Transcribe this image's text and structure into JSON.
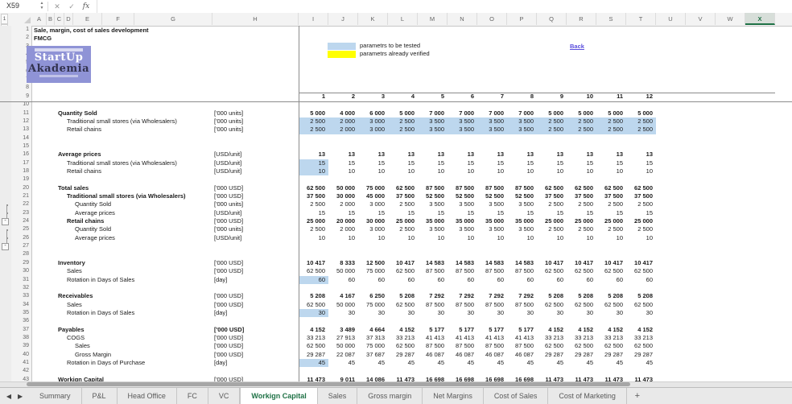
{
  "formula_bar": {
    "name_box": "X59",
    "cancel_label": "✕",
    "enter_label": "✓",
    "fx_label": "fx",
    "formula_value": ""
  },
  "colors": {
    "highlight_blue": "#BDD7EE",
    "verified_yellow": "#FFFF00",
    "active_tab_green": "#1E7145",
    "link_color": "#5B4FDD",
    "logo_purple": "#8F93D6"
  },
  "sheet": {
    "title": "Sale, margin, cost of sales development",
    "subtitle": "FMCG",
    "logo": {
      "line1": "StartUp",
      "line2": "Akademia"
    },
    "legend": [
      {
        "label": "parametrs to be tested",
        "color": "#BDD7EE"
      },
      {
        "label": "parametrs already verified",
        "color": "#FFFF00"
      }
    ],
    "back_link": "Back",
    "column_letters": [
      "A",
      "B",
      "C",
      "D",
      "E",
      "F",
      "G",
      "H",
      "I",
      "J",
      "K",
      "L",
      "M",
      "N",
      "O",
      "P",
      "Q",
      "R",
      "S",
      "T",
      "U",
      "V",
      "W",
      "X"
    ],
    "selected_column": "X",
    "outline_levels": [
      "1",
      "2"
    ],
    "outline": {
      "detail_rows": [
        22,
        23,
        25,
        26
      ],
      "collapse_rows": [
        24,
        27
      ],
      "collapse_symbol": "-"
    },
    "visible_row_count": 44,
    "period_headers": [
      "1",
      "2",
      "3",
      "4",
      "5",
      "6",
      "7",
      "8",
      "9",
      "10",
      "11",
      "12"
    ],
    "rows": [
      {
        "row": 11,
        "label": "Quantity Sold",
        "unit": "['000 units]",
        "bold": true,
        "indent": 1,
        "values": [
          "5 000",
          "4 000",
          "6 000",
          "5 000",
          "7 000",
          "7 000",
          "7 000",
          "7 000",
          "5 000",
          "5 000",
          "5 000",
          "5 000"
        ]
      },
      {
        "row": 12,
        "label": "Traditional small stores (via Wholesalers)",
        "unit": "['000 units]",
        "indent": 2,
        "highlight": "row",
        "values": [
          "2 500",
          "2 000",
          "3 000",
          "2 500",
          "3 500",
          "3 500",
          "3 500",
          "3 500",
          "2 500",
          "2 500",
          "2 500",
          "2 500"
        ]
      },
      {
        "row": 13,
        "label": "Retail chains",
        "unit": "['000 units]",
        "indent": 2,
        "highlight": "row",
        "values": [
          "2 500",
          "2 000",
          "3 000",
          "2 500",
          "3 500",
          "3 500",
          "3 500",
          "3 500",
          "2 500",
          "2 500",
          "2 500",
          "2 500"
        ]
      },
      {
        "row": 16,
        "label": "Average prices",
        "unit": "[USD/unit]",
        "bold": true,
        "indent": 1,
        "values": [
          "13",
          "13",
          "13",
          "13",
          "13",
          "13",
          "13",
          "13",
          "13",
          "13",
          "13",
          "13"
        ]
      },
      {
        "row": 17,
        "label": "Traditional small stores (via Wholesalers)",
        "unit": "[USD/unit]",
        "indent": 2,
        "highlight": "first",
        "values": [
          "15",
          "15",
          "15",
          "15",
          "15",
          "15",
          "15",
          "15",
          "15",
          "15",
          "15",
          "15"
        ]
      },
      {
        "row": 18,
        "label": "Retail chains",
        "unit": "[USD/unit]",
        "indent": 2,
        "highlight": "first",
        "values": [
          "10",
          "10",
          "10",
          "10",
          "10",
          "10",
          "10",
          "10",
          "10",
          "10",
          "10",
          "10"
        ]
      },
      {
        "row": 20,
        "label": "Total sales",
        "unit": "['000 USD]",
        "bold": true,
        "indent": 1,
        "values": [
          "62 500",
          "50 000",
          "75 000",
          "62 500",
          "87 500",
          "87 500",
          "87 500",
          "87 500",
          "62 500",
          "62 500",
          "62 500",
          "62 500"
        ]
      },
      {
        "row": 21,
        "label": "Traditional small stores (via Wholesalers)",
        "unit": "['000 USD]",
        "bold": true,
        "indent": 2,
        "values": [
          "37 500",
          "30 000",
          "45 000",
          "37 500",
          "52 500",
          "52 500",
          "52 500",
          "52 500",
          "37 500",
          "37 500",
          "37 500",
          "37 500"
        ]
      },
      {
        "row": 22,
        "label": "Quantity Sold",
        "unit": "['000 units]",
        "indent": 3,
        "values": [
          "2 500",
          "2 000",
          "3 000",
          "2 500",
          "3 500",
          "3 500",
          "3 500",
          "3 500",
          "2 500",
          "2 500",
          "2 500",
          "2 500"
        ]
      },
      {
        "row": 23,
        "label": "Average prices",
        "unit": "[USD/unit]",
        "indent": 3,
        "values": [
          "15",
          "15",
          "15",
          "15",
          "15",
          "15",
          "15",
          "15",
          "15",
          "15",
          "15",
          "15"
        ]
      },
      {
        "row": 24,
        "label": "Retail chains",
        "unit": "['000 USD]",
        "bold": true,
        "indent": 2,
        "values": [
          "25 000",
          "20 000",
          "30 000",
          "25 000",
          "35 000",
          "35 000",
          "35 000",
          "35 000",
          "25 000",
          "25 000",
          "25 000",
          "25 000"
        ]
      },
      {
        "row": 25,
        "label": "Quantity Sold",
        "unit": "['000 units]",
        "indent": 3,
        "values": [
          "2 500",
          "2 000",
          "3 000",
          "2 500",
          "3 500",
          "3 500",
          "3 500",
          "3 500",
          "2 500",
          "2 500",
          "2 500",
          "2 500"
        ]
      },
      {
        "row": 26,
        "label": "Average prices",
        "unit": "[USD/unit]",
        "indent": 3,
        "values": [
          "10",
          "10",
          "10",
          "10",
          "10",
          "10",
          "10",
          "10",
          "10",
          "10",
          "10",
          "10"
        ]
      },
      {
        "row": 29,
        "label": "Inventory",
        "unit": "['000 USD]",
        "bold": true,
        "indent": 1,
        "values": [
          "10 417",
          "8 333",
          "12 500",
          "10 417",
          "14 583",
          "14 583",
          "14 583",
          "14 583",
          "10 417",
          "10 417",
          "10 417",
          "10 417"
        ]
      },
      {
        "row": 30,
        "label": "Sales",
        "unit": "['000 USD]",
        "indent": 2,
        "values": [
          "62 500",
          "50 000",
          "75 000",
          "62 500",
          "87 500",
          "87 500",
          "87 500",
          "87 500",
          "62 500",
          "62 500",
          "62 500",
          "62 500"
        ]
      },
      {
        "row": 31,
        "label": "Rotation in Days of Sales",
        "unit": "[day]",
        "indent": 2,
        "highlight": "first",
        "values": [
          "60",
          "60",
          "60",
          "60",
          "60",
          "60",
          "60",
          "60",
          "60",
          "60",
          "60",
          "60"
        ]
      },
      {
        "row": 33,
        "label": "Receivables",
        "unit": "['000 USD]",
        "bold": true,
        "indent": 1,
        "values": [
          "5 208",
          "4 167",
          "6 250",
          "5 208",
          "7 292",
          "7 292",
          "7 292",
          "7 292",
          "5 208",
          "5 208",
          "5 208",
          "5 208"
        ]
      },
      {
        "row": 34,
        "label": "Sales",
        "unit": "['000 USD]",
        "indent": 2,
        "values": [
          "62 500",
          "50 000",
          "75 000",
          "62 500",
          "87 500",
          "87 500",
          "87 500",
          "87 500",
          "62 500",
          "62 500",
          "62 500",
          "62 500"
        ]
      },
      {
        "row": 35,
        "label": "Rotation in Days of Sales",
        "unit": "[day]",
        "indent": 2,
        "highlight": "first",
        "values": [
          "30",
          "30",
          "30",
          "30",
          "30",
          "30",
          "30",
          "30",
          "30",
          "30",
          "30",
          "30"
        ]
      },
      {
        "row": 37,
        "label": "Payables",
        "unit": "['000 USD]",
        "bold": true,
        "unit_bold": true,
        "indent": 1,
        "values": [
          "4 152",
          "3 489",
          "4 664",
          "4 152",
          "5 177",
          "5 177",
          "5 177",
          "5 177",
          "4 152",
          "4 152",
          "4 152",
          "4 152"
        ]
      },
      {
        "row": 38,
        "label": "COGS",
        "unit": "['000 USD]",
        "indent": 2,
        "values": [
          "33 213",
          "27 913",
          "37 313",
          "33 213",
          "41 413",
          "41 413",
          "41 413",
          "41 413",
          "33 213",
          "33 213",
          "33 213",
          "33 213"
        ]
      },
      {
        "row": 39,
        "label": "Sales",
        "unit": "['000 USD]",
        "indent": 3,
        "values": [
          "62 500",
          "50 000",
          "75 000",
          "62 500",
          "87 500",
          "87 500",
          "87 500",
          "87 500",
          "62 500",
          "62 500",
          "62 500",
          "62 500"
        ]
      },
      {
        "row": 40,
        "label": "Gross Margin",
        "unit": "['000 USD]",
        "indent": 3,
        "values": [
          "29 287",
          "22 087",
          "37 687",
          "29 287",
          "46 087",
          "46 087",
          "46 087",
          "46 087",
          "29 287",
          "29 287",
          "29 287",
          "29 287"
        ]
      },
      {
        "row": 41,
        "label": "Rotation in Days of Purchase",
        "unit": "[day]",
        "indent": 2,
        "highlight": "first",
        "values": [
          "45",
          "45",
          "45",
          "45",
          "45",
          "45",
          "45",
          "45",
          "45",
          "45",
          "45",
          "45"
        ]
      },
      {
        "row": 43,
        "label": "Workign Capital",
        "unit": "['000 USD]",
        "bold": true,
        "indent": 1,
        "values": [
          "11 473",
          "9 011",
          "14 086",
          "11 473",
          "16 698",
          "16 698",
          "16 698",
          "16 698",
          "11 473",
          "11 473",
          "11 473",
          "11 473"
        ]
      }
    ]
  },
  "tabs": {
    "items": [
      "Summary",
      "P&L",
      "Head Office",
      "FC",
      "VC",
      "Workign Capital",
      "Sales",
      "Gross margin",
      "Net Margins",
      "Cost of Sales",
      "Cost of Marketing"
    ],
    "active": "Workign Capital",
    "add_label": "+",
    "nav_left": "◀",
    "nav_right": "▶"
  }
}
